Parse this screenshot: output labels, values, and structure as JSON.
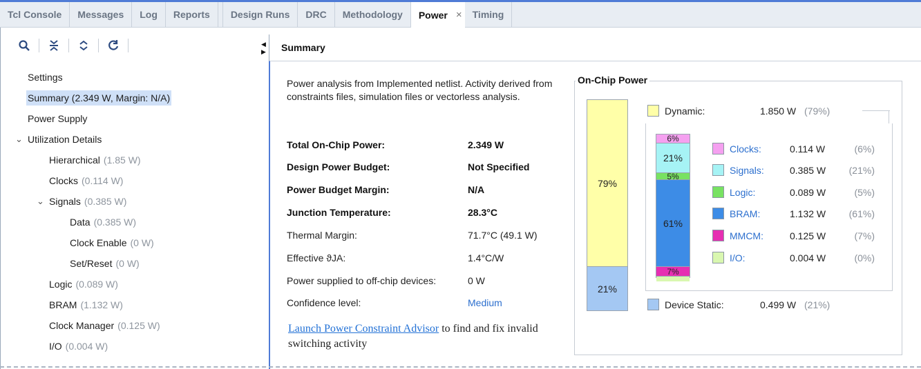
{
  "tabs": [
    {
      "label": "Tcl Console",
      "active": false
    },
    {
      "label": "Messages",
      "active": false
    },
    {
      "label": "Log",
      "active": false
    },
    {
      "label": "Reports",
      "active": false
    },
    {
      "label": "Design Runs",
      "active": false
    },
    {
      "label": "DRC",
      "active": false
    },
    {
      "label": "Methodology",
      "active": false
    },
    {
      "label": "Power",
      "active": true,
      "closable": true,
      "close_glyph": "×"
    },
    {
      "label": "Timing",
      "active": false
    }
  ],
  "toolbar": {
    "icons": [
      "search-icon",
      "collapse-all-icon",
      "expand-all-icon",
      "refresh-icon"
    ]
  },
  "tree": [
    {
      "label": "Settings",
      "value": "",
      "level": 0
    },
    {
      "label": "Summary (2.349 W, Margin: N/A)",
      "value": "",
      "level": 0,
      "selected": true
    },
    {
      "label": "Power Supply",
      "value": "",
      "level": 0
    },
    {
      "label": "Utilization Details",
      "value": "",
      "level": 0,
      "expanded": true
    },
    {
      "label": "Hierarchical",
      "value": "(1.85 W)",
      "level": 1
    },
    {
      "label": "Clocks",
      "value": "(0.114 W)",
      "level": 1
    },
    {
      "label": "Signals",
      "value": "(0.385 W)",
      "level": 1,
      "expanded": true
    },
    {
      "label": "Data",
      "value": "(0.385 W)",
      "level": 2
    },
    {
      "label": "Clock Enable",
      "value": "(0 W)",
      "level": 2
    },
    {
      "label": "Set/Reset",
      "value": "(0 W)",
      "level": 2
    },
    {
      "label": "Logic",
      "value": "(0.089 W)",
      "level": 1
    },
    {
      "label": "BRAM",
      "value": "(1.132 W)",
      "level": 1
    },
    {
      "label": "Clock Manager",
      "value": "(0.125 W)",
      "level": 1
    },
    {
      "label": "I/O",
      "value": "(0.004 W)",
      "level": 1
    }
  ],
  "summary": {
    "title": "Summary",
    "description": "Power analysis from Implemented netlist. Activity derived from constraints files, simulation files or vectorless analysis.",
    "rows": [
      {
        "key": "Total On-Chip Power:",
        "value": "2.349 W",
        "bold": true
      },
      {
        "key": "Design Power Budget:",
        "value": "Not Specified",
        "bold": true
      },
      {
        "key": "Power Budget Margin:",
        "value": "N/A",
        "bold": true
      },
      {
        "key": "Junction Temperature:",
        "value": "28.3°C",
        "bold": true
      },
      {
        "key": "Thermal Margin:",
        "value": "71.7°C (49.1 W)",
        "bold": false
      },
      {
        "key": "Effective ϑJA:",
        "value": "1.4°C/W",
        "bold": false
      },
      {
        "key": "Power supplied to off-chip devices:",
        "value": "0 W",
        "bold": false
      },
      {
        "key": "Confidence level:",
        "value": "Medium",
        "bold": false,
        "link": true
      }
    ],
    "advisor_link": "Launch Power Constraint Advisor",
    "advisor_text": " to find and fix invalid switching activity"
  },
  "on_chip": {
    "title": "On-Chip Power",
    "dynamic": {
      "label": "Dynamic:",
      "value": "1.850 W",
      "pct": "(79%)",
      "bar_label": "79%",
      "fraction": 0.79,
      "color": "#ffffa8"
    },
    "static": {
      "label": "Device Static:",
      "value": "0.499 W",
      "pct": "(21%)",
      "bar_label": "21%",
      "fraction": 0.21,
      "color": "#a4c8f3"
    },
    "categories": [
      {
        "name": "Clocks:",
        "value": "0.114 W",
        "pct": "(6%)",
        "bar_label": "6%",
        "fraction": 0.06,
        "color": "#f5a0f0"
      },
      {
        "name": "Signals:",
        "value": "0.385 W",
        "pct": "(21%)",
        "bar_label": "21%",
        "fraction": 0.21,
        "color": "#a6f3f5"
      },
      {
        "name": "Logic:",
        "value": "0.089 W",
        "pct": "(5%)",
        "bar_label": "5%",
        "fraction": 0.05,
        "color": "#78e262"
      },
      {
        "name": "BRAM:",
        "value": "1.132 W",
        "pct": "(61%)",
        "bar_label": "61%",
        "fraction": 0.61,
        "color": "#3d8ce6"
      },
      {
        "name": "MMCM:",
        "value": "0.125 W",
        "pct": "(7%)",
        "bar_label": "7%",
        "fraction": 0.07,
        "color": "#e62eb2"
      },
      {
        "name": "I/O:",
        "value": "0.004 W",
        "pct": "(0%)",
        "bar_label": "",
        "fraction": 0.0,
        "color": "#d9f7b0"
      }
    ]
  }
}
